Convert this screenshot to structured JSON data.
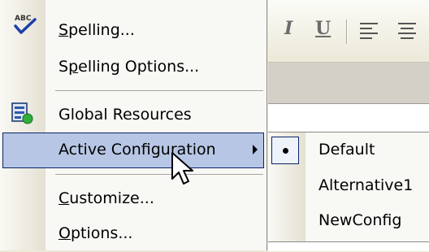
{
  "menu": {
    "items": [
      {
        "pre": "",
        "key": "S",
        "post": "pelling...",
        "icon": "spellcheck-abc-icon"
      },
      {
        "pre": "S",
        "key": "p",
        "post": "elling Options..."
      },
      {
        "pre": "Global Resources",
        "key": "",
        "post": "",
        "icon": "global-resources-icon"
      },
      {
        "pre": "Active Confi",
        "key": "g",
        "post": "uration",
        "submenu": true,
        "highlighted": true
      },
      {
        "pre": "",
        "key": "C",
        "post": "ustomize..."
      },
      {
        "pre": "",
        "key": "O",
        "post": "ptions..."
      }
    ]
  },
  "submenu": {
    "items": [
      {
        "label": "Default",
        "selected": true
      },
      {
        "label": "Alternative1",
        "selected": false
      },
      {
        "label": "NewConfig",
        "selected": false
      }
    ]
  },
  "toolbar": {
    "italic_label": "I",
    "underline_label": "U"
  },
  "colors": {
    "highlight": "#b7c6e4",
    "highlight_border": "#0a246a",
    "menu_bg": "#f8f8f5"
  }
}
